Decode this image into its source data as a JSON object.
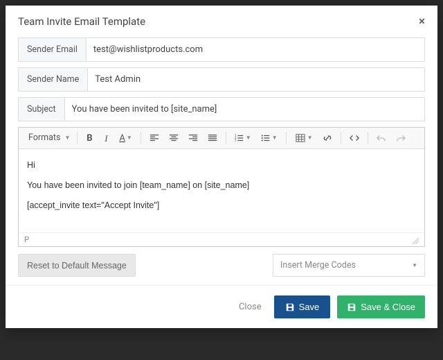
{
  "modal": {
    "title": "Team Invite Email Template"
  },
  "fields": {
    "sender_email": {
      "label": "Sender Email",
      "value": "test@wishlistproducts.com"
    },
    "sender_name": {
      "label": "Sender Name",
      "value": "Test Admin"
    },
    "subject": {
      "label": "Subject",
      "value": "You have been invited to [site_name]"
    }
  },
  "toolbar": {
    "formats_label": "Formats"
  },
  "editor": {
    "line1": "Hi",
    "line2": "You have been invited to join [team_name] on [site_name]",
    "line3": "[accept_invite text=\"Accept Invite\"]",
    "status_path": "P"
  },
  "actions": {
    "reset_label": "Reset to Default Message",
    "merge_placeholder": "Insert Merge Codes",
    "close_label": "Close",
    "save_label": "Save",
    "save_close_label": "Save & Close"
  }
}
